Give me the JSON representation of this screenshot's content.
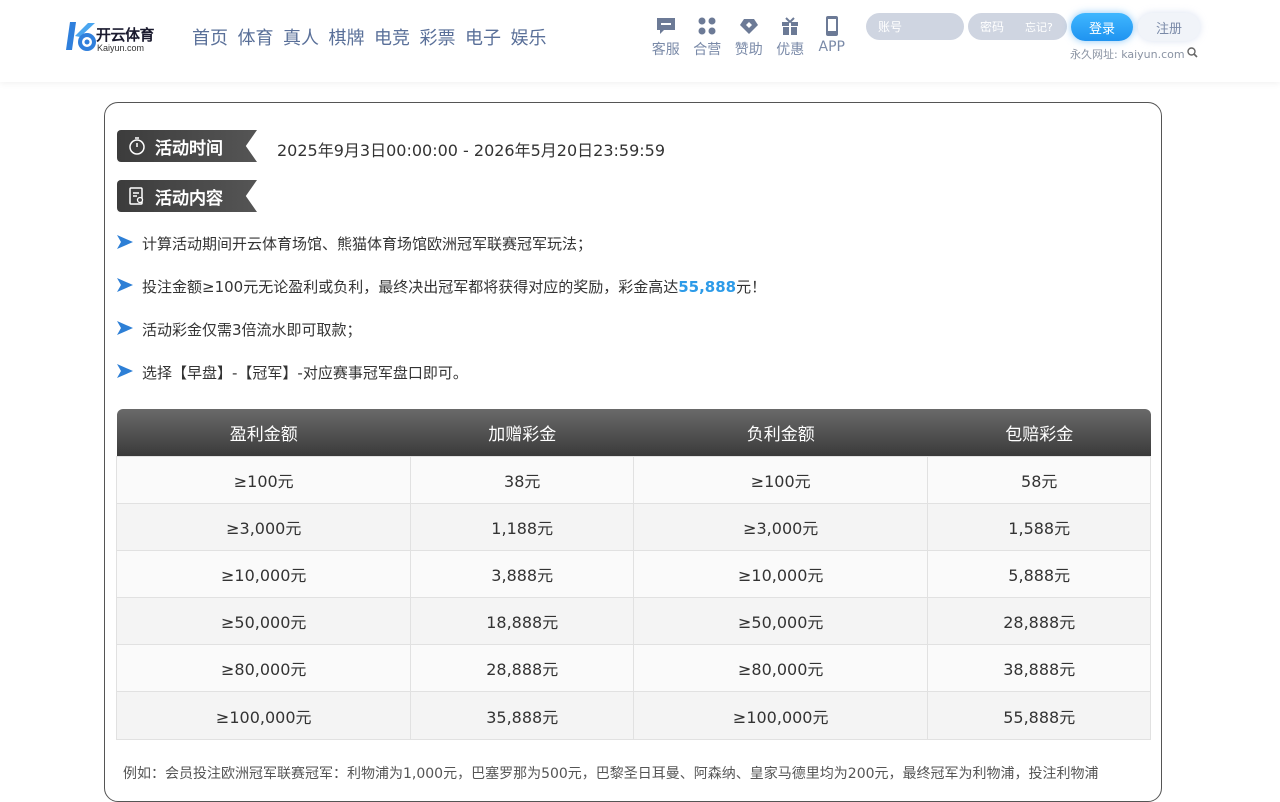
{
  "header": {
    "logo_cn": "开云体育",
    "logo_en": "Kaiyun.com",
    "nav": [
      "首页",
      "体育",
      "真人",
      "棋牌",
      "电竞",
      "彩票",
      "电子",
      "娱乐"
    ],
    "tools": [
      {
        "label": "客服",
        "icon": "chat-icon"
      },
      {
        "label": "合营",
        "icon": "partner-icon"
      },
      {
        "label": "赞助",
        "icon": "sponsor-icon"
      },
      {
        "label": "优惠",
        "icon": "gift-icon"
      },
      {
        "label": "APP",
        "icon": "phone-icon"
      }
    ],
    "login": {
      "username_placeholder": "账号",
      "password_placeholder": "密码",
      "forgot": "忘记?",
      "login_label": "登录",
      "register_label": "注册",
      "permanent_url": "永久网址: kaiyun.com"
    }
  },
  "activity": {
    "time_tag": "活动时间",
    "time_range": "2025年9月3日00:00:00 - 2026年5月20日23:59:59",
    "content_tag": "活动内容",
    "rules": [
      "计算活动期间开云体育场馆、熊猫体育场馆欧洲冠军联赛冠军玩法；",
      "投注金额≥100元无论盈利或负利，最终决出冠军都将获得对应的奖励，彩金高达",
      "活动彩金仅需3倍流水即可取款；",
      "选择【早盘】-【冠军】-对应赛事冠军盘口即可。"
    ],
    "rule2_highlight": "55,888",
    "rule2_suffix": "元！",
    "table": {
      "headers": [
        "盈利金额",
        "加赠彩金",
        "负利金额",
        "包赔彩金"
      ],
      "rows": [
        [
          "≥100元",
          "38元",
          "≥100元",
          "58元"
        ],
        [
          "≥3,000元",
          "1,188元",
          "≥3,000元",
          "1,588元"
        ],
        [
          "≥10,000元",
          "3,888元",
          "≥10,000元",
          "5,888元"
        ],
        [
          "≥50,000元",
          "18,888元",
          "≥50,000元",
          "28,888元"
        ],
        [
          "≥80,000元",
          "28,888元",
          "≥80,000元",
          "38,888元"
        ],
        [
          "≥100,000元",
          "35,888元",
          "≥100,000元",
          "55,888元"
        ]
      ]
    },
    "example": "例如：会员投注欧洲冠军联赛冠军：利物浦为1,000元，巴塞罗那为500元，巴黎圣日耳曼、阿森纳、皇家马德里均为200元，最终冠军为利物浦，投注利物浦"
  },
  "colors": {
    "nav_text": "#5a7099",
    "highlight": "#2d9be8",
    "login_button": "#1f93f0",
    "tag_bg": "#444444"
  }
}
